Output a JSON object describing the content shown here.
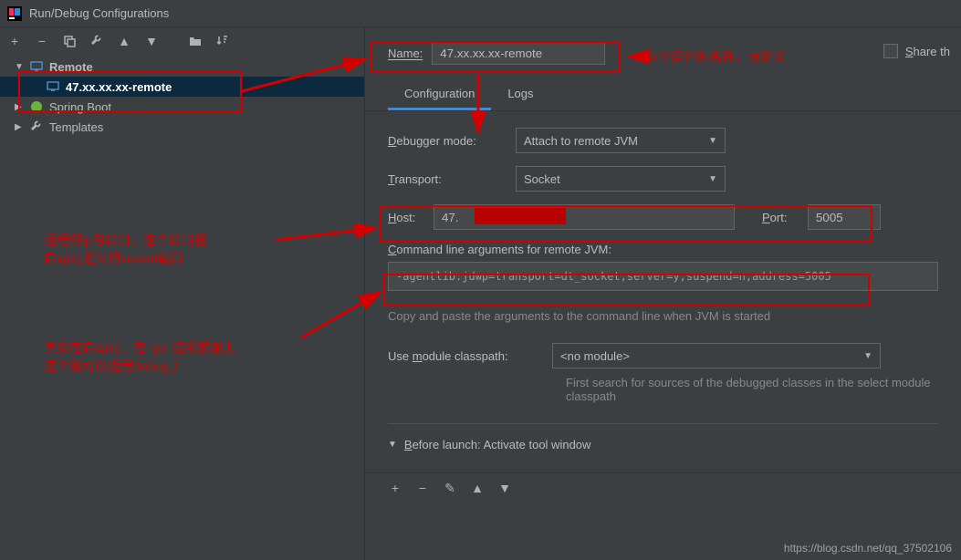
{
  "window": {
    "title": "Run/Debug Configurations"
  },
  "sidebar": {
    "items": [
      {
        "label": "Remote",
        "expanded": true,
        "icon": "remote"
      },
      {
        "label": "47.xx.xx.xx-remote",
        "child": true,
        "selected": true
      },
      {
        "label": "Spring Boot",
        "expanded": false,
        "icon": "spring"
      },
      {
        "label": "Templates",
        "expanded": false,
        "icon": "templates"
      }
    ]
  },
  "form": {
    "name_label": "Name:",
    "name_value": "47.xx.xx.xx-remote",
    "share_label": "Share th",
    "tabs": {
      "configuration": "Configuration",
      "logs": "Logs"
    },
    "debugger_mode_label": "Debugger mode:",
    "debugger_mode_value": "Attach to remote JVM",
    "transport_label": "Transport:",
    "transport_value": "Socket",
    "host_label": "Host:",
    "host_value": "47.",
    "port_label": "Port:",
    "port_value": "5005",
    "cmd_label": "Command line arguments for remote JVM:",
    "cmd_value": "-agentlib:jdwp=transport=dt_socket,server=y,suspend=n,address=5005",
    "help1": "Copy and paste the arguments to the command line when JVM is started",
    "module_label": "Use module classpath:",
    "module_value": "<no module>",
    "help2": "First search for sources of the debugged classes in the select module classpath",
    "before_launch": "Before launch: Activate tool window"
  },
  "annotations": {
    "note1": "这个运行的名称，自定义",
    "note2a": "远程的ip与端口，这个端口是",
    "note2b": "启动时定义的socket端口",
    "note3a": "其实在启动时，在 -jar 选项前加上",
    "note3b": "这个就可以远程debug了"
  },
  "watermark": "https://blog.csdn.net/qq_37502106"
}
